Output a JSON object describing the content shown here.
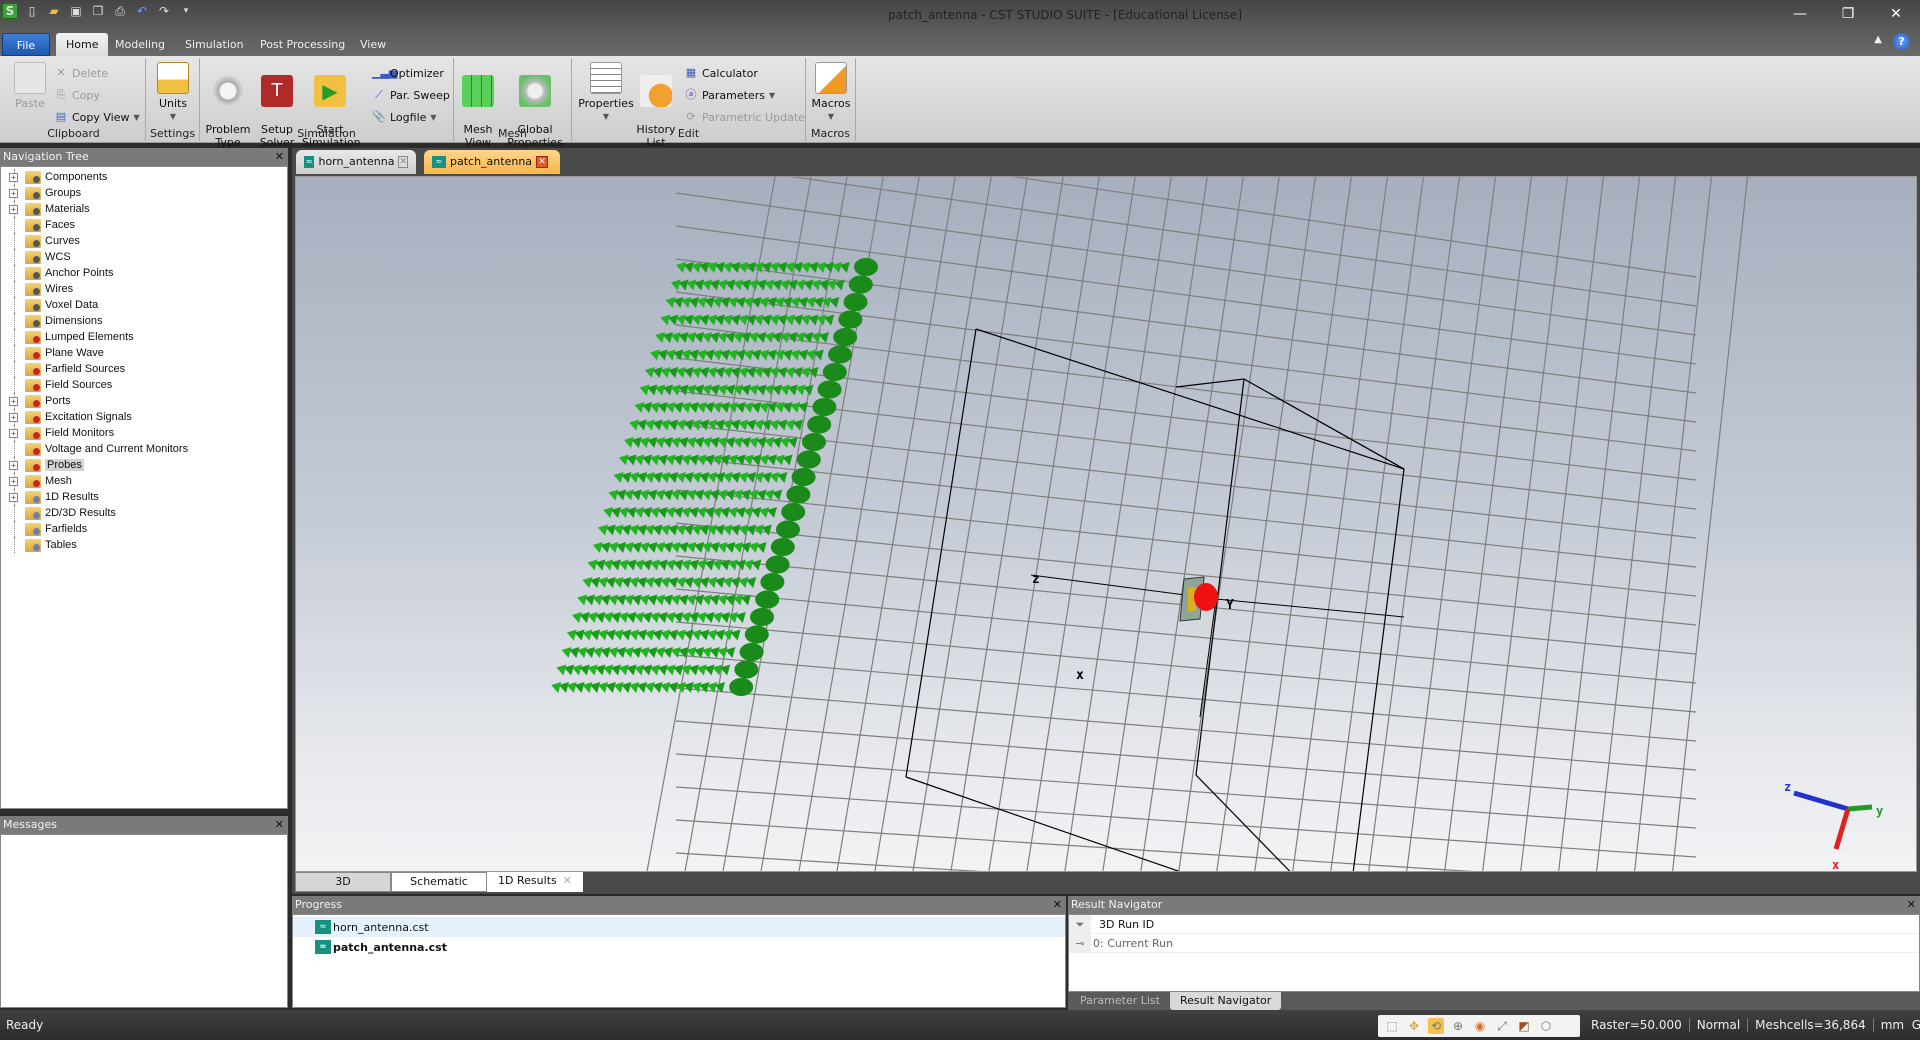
{
  "window": {
    "title": "patch_antenna - CST STUDIO SUITE - [Educational License]",
    "controls": {
      "minimize": "—",
      "restore": "❐",
      "close": "✕"
    }
  },
  "quick_access": [
    "new-file-icon",
    "open-folder-icon",
    "save-icon",
    "save-all-icon",
    "print-icon",
    "undo-icon",
    "redo-icon",
    "customize-icon"
  ],
  "ribbon_tabs": [
    {
      "label": "File"
    },
    {
      "label": "Home",
      "active": true
    },
    {
      "label": "Modeling"
    },
    {
      "label": "Simulation"
    },
    {
      "label": "Post Processing"
    },
    {
      "label": "View"
    }
  ],
  "ribbon": {
    "clipboard": {
      "group": "Clipboard",
      "paste": "Paste",
      "delete": "Delete",
      "copy": "Copy",
      "copy_view": "Copy View"
    },
    "settings": {
      "group": "Settings",
      "units": "Units"
    },
    "simulation": {
      "group": "Simulation",
      "problem_type": "Problem\nType",
      "setup_solver": "Setup\nSolver",
      "start_simulation": "Start\nSimulation",
      "optimizer": "Optimizer",
      "par_sweep": "Par. Sweep",
      "logfile": "Logfile"
    },
    "mesh": {
      "group": "Mesh",
      "mesh_view": "Mesh\nView",
      "global_properties": "Global\nProperties"
    },
    "edit": {
      "group": "Edit",
      "properties": "Properties",
      "history_list": "History\nList",
      "calculator": "Calculator",
      "parameters": "Parameters",
      "parametric_update": "Parametric Update"
    },
    "macros": {
      "group": "Macros",
      "macros": "Macros"
    }
  },
  "navigation_tree": {
    "title": "Navigation Tree",
    "items": [
      {
        "label": "Components",
        "expandable": true,
        "kind": "geo"
      },
      {
        "label": "Groups",
        "expandable": true,
        "kind": "geo"
      },
      {
        "label": "Materials",
        "expandable": true,
        "kind": "geo"
      },
      {
        "label": "Faces",
        "expandable": false,
        "kind": "geo"
      },
      {
        "label": "Curves",
        "expandable": false,
        "kind": "geo"
      },
      {
        "label": "WCS",
        "expandable": false,
        "kind": "geo"
      },
      {
        "label": "Anchor Points",
        "expandable": false,
        "kind": "geo"
      },
      {
        "label": "Wires",
        "expandable": false,
        "kind": "geo"
      },
      {
        "label": "Voxel Data",
        "expandable": false,
        "kind": "geo"
      },
      {
        "label": "Dimensions",
        "expandable": false,
        "kind": "geo"
      },
      {
        "label": "Lumped Elements",
        "expandable": false,
        "kind": "src"
      },
      {
        "label": "Plane Wave",
        "expandable": false,
        "kind": "src"
      },
      {
        "label": "Farfield Sources",
        "expandable": false,
        "kind": "src"
      },
      {
        "label": "Field Sources",
        "expandable": false,
        "kind": "src"
      },
      {
        "label": "Ports",
        "expandable": true,
        "kind": "src"
      },
      {
        "label": "Excitation Signals",
        "expandable": true,
        "kind": "src"
      },
      {
        "label": "Field Monitors",
        "expandable": true,
        "kind": "src"
      },
      {
        "label": "Voltage and Current Monitors",
        "expandable": false,
        "kind": "src"
      },
      {
        "label": "Probes",
        "expandable": true,
        "kind": "src",
        "selected": true
      },
      {
        "label": "Mesh",
        "expandable": true,
        "kind": "src"
      },
      {
        "label": "1D Results",
        "expandable": true,
        "kind": "res"
      },
      {
        "label": "2D/3D Results",
        "expandable": false,
        "kind": "res"
      },
      {
        "label": "Farfields",
        "expandable": false,
        "kind": "res"
      },
      {
        "label": "Tables",
        "expandable": false,
        "kind": "res"
      }
    ]
  },
  "messages": {
    "title": "Messages"
  },
  "document_tabs": [
    {
      "label": "horn_antenna",
      "active": false
    },
    {
      "label": "patch_antenna",
      "active": true
    }
  ],
  "viewport": {
    "axis_labels": {
      "x": "x",
      "y": "Y",
      "z": "z"
    },
    "triad_labels": {
      "x": "x",
      "y": "y",
      "z": "z"
    },
    "colors": {
      "field_arrows": "#22b422",
      "triad_x": "#dd2222",
      "triad_y": "#229922",
      "triad_z": "#2233cc",
      "port": "#ee1111"
    }
  },
  "view_tabs": [
    {
      "label": "3D",
      "active": true
    },
    {
      "label": "Schematic",
      "active": false
    },
    {
      "label": "1D Results",
      "active": false,
      "closable": true
    }
  ],
  "progress": {
    "title": "Progress",
    "items": [
      {
        "label": "horn_antenna.cst",
        "bold": false
      },
      {
        "label": "patch_antenna.cst",
        "bold": true
      }
    ]
  },
  "result_navigator": {
    "title": "Result Navigator",
    "column": "3D Run ID",
    "rows": [
      {
        "label": "0: Current Run"
      }
    ],
    "tabs": [
      {
        "label": "Parameter List",
        "active": false
      },
      {
        "label": "Result Navigator",
        "active": true
      }
    ]
  },
  "status": {
    "text": "Ready",
    "raster": "Raster=50.000",
    "mode": "Normal",
    "meshcells": "Meshcells=36,864",
    "units": "mm  GHz  ns  K"
  }
}
